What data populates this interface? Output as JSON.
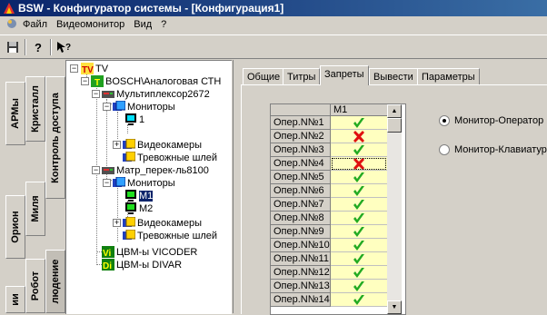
{
  "window": {
    "title": "BSW - Конфигуратор системы - [Конфигурация1]"
  },
  "menu": [
    "Файл",
    "Видеомонитор",
    "Вид",
    "?"
  ],
  "toolbar": {
    "save_icon": "floppy-save-icon",
    "help_icon": "help-question-icon",
    "whatsthis_icon": "context-help-icon"
  },
  "left_tabs": {
    "col1": [
      "АРМы",
      "Орион",
      "ии"
    ],
    "col2": [
      "Кристалл",
      "Миля",
      "Робот"
    ],
    "col3": [
      "Контроль доступа",
      "людение"
    ]
  },
  "tree": {
    "root": "TV",
    "bosch": "BOSCH\\Аналоговая СТН",
    "multiplexer": "Мультиплексор2672",
    "monitors": "Мониторы",
    "mon1": "1",
    "cameras": "Видеокамеры",
    "alarms": "Тревожные шлей",
    "matrix": "Матр_перек-ль8100",
    "monitors2": "Мониторы",
    "m1": "M1",
    "m2": "M2",
    "cameras2": "Видеокамеры",
    "alarms2": "Тревожные шлей",
    "vicoder": "ЦВМ-ы VICODER",
    "divar": "ЦВМ-ы DIVAR"
  },
  "tabs": [
    "Общие",
    "Титры",
    "Запреты",
    "Вывести",
    "Параметры"
  ],
  "active_tab": "Запреты",
  "grid": {
    "column": "M1",
    "rows": [
      {
        "label": "Опер.N№1",
        "allowed": true
      },
      {
        "label": "Опер.N№2",
        "allowed": false
      },
      {
        "label": "Опер.N№3",
        "allowed": true
      },
      {
        "label": "Опер.N№4",
        "allowed": false
      },
      {
        "label": "Опер.N№5",
        "allowed": true
      },
      {
        "label": "Опер.N№6",
        "allowed": true
      },
      {
        "label": "Опер.N№7",
        "allowed": true
      },
      {
        "label": "Опер.N№8",
        "allowed": true
      },
      {
        "label": "Опер.N№9",
        "allowed": true
      },
      {
        "label": "Опер.N№10",
        "allowed": true
      },
      {
        "label": "Опер.N№11",
        "allowed": true
      },
      {
        "label": "Опер.N№12",
        "allowed": true
      },
      {
        "label": "Опер.N№13",
        "allowed": true
      },
      {
        "label": "Опер.N№14",
        "allowed": true
      }
    ],
    "check_color": "#22aa22",
    "cross_color": "#e01010"
  },
  "radios": {
    "option1": "Монитор-Оператор",
    "option2": "Монитор-Клавиатура",
    "selected": "option1"
  }
}
